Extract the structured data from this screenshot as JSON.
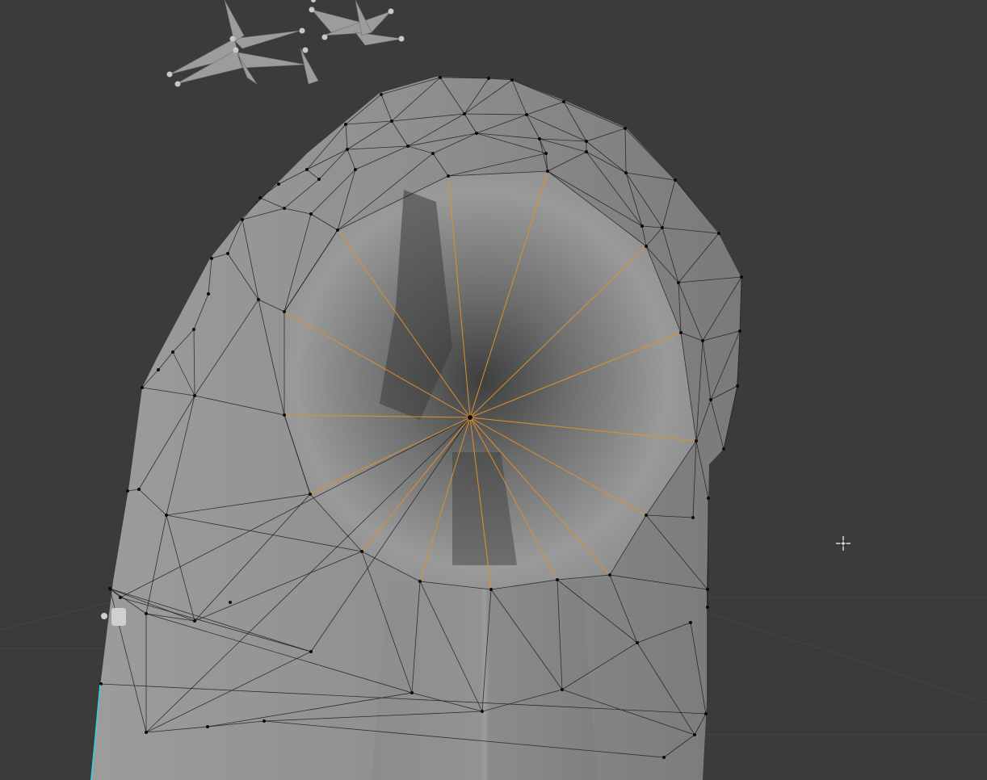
{
  "app": "Blender",
  "viewport": {
    "mode": "edit-mode",
    "background_color": "#3b3b3b",
    "mesh_color": "#8e8e8e",
    "selection_color": "#e0902a",
    "active_edge_color": "#2ad6e6",
    "cursor_icon": "3d-cursor-icon",
    "armature_icon": "bone-icon",
    "light_icon": "light-empty-icon"
  }
}
